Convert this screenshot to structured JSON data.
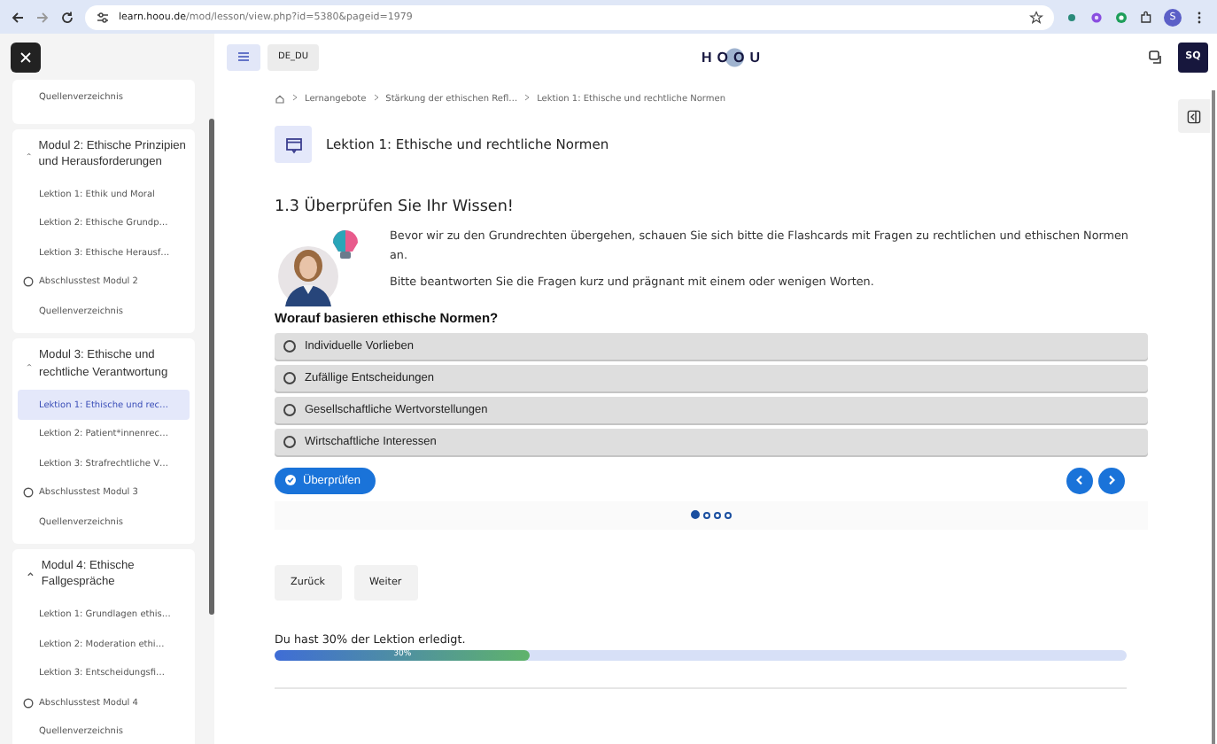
{
  "browser": {
    "url_host": "learn.hoou.de",
    "url_path": "/mod/lesson/view.php?id=5380&pageid=1979",
    "profile": "S"
  },
  "header": {
    "language": "DE_DU",
    "logo": "HOOU",
    "user": "SQ"
  },
  "sidebar": {
    "items": [
      {
        "kind": "sources",
        "label": "Quellenverzeichnis",
        "selected": false
      },
      {
        "kind": "module",
        "label": "Modul 2: Ethische Prinzipien und Herausforderungen",
        "expanded": true,
        "children": [
          {
            "kind": "lesson",
            "label": "Lektion 1: Ethik und Moral",
            "selected": false
          },
          {
            "kind": "lesson",
            "label": "Lektion 2: Ethische Grundp…",
            "selected": false
          },
          {
            "kind": "lesson",
            "label": "Lektion 3: Ethische Herausf…",
            "selected": false
          },
          {
            "kind": "test",
            "label": "Abschlusstest Modul 2",
            "selected": false
          },
          {
            "kind": "lesson",
            "label": "Quellenverzeichnis",
            "selected": false
          }
        ]
      },
      {
        "kind": "module",
        "label": "Modul 3: Ethische und rechtliche Verantwortung",
        "expanded": true,
        "children": [
          {
            "kind": "lesson",
            "label": "Lektion 1: Ethische und rec…",
            "selected": true
          },
          {
            "kind": "lesson",
            "label": "Lektion 2: Patient*innenrec…",
            "selected": false
          },
          {
            "kind": "lesson",
            "label": "Lektion 3: Strafrechtliche V…",
            "selected": false
          },
          {
            "kind": "test",
            "label": "Abschlusstest Modul 3",
            "selected": false
          },
          {
            "kind": "lesson",
            "label": "Quellenverzeichnis",
            "selected": false
          }
        ]
      },
      {
        "kind": "module",
        "label": "Modul 4: Ethische Fallgespräche",
        "expanded": true,
        "children": [
          {
            "kind": "lesson",
            "label": "Lektion 1: Grundlagen ethis…",
            "selected": false
          },
          {
            "kind": "lesson",
            "label": "Lektion 2: Moderation ethi…",
            "selected": false
          },
          {
            "kind": "lesson",
            "label": "Lektion 3: Entscheidungsfi…",
            "selected": false
          },
          {
            "kind": "test",
            "label": "Abschlusstest Modul 4",
            "selected": false
          },
          {
            "kind": "lesson",
            "label": "Quellenverzeichnis",
            "selected": false
          }
        ]
      }
    ]
  },
  "breadcrumb": [
    "Lernangebote",
    "Stärkung der ethischen Refl…",
    "Lektion 1: Ethische und rechtliche Normen"
  ],
  "lesson_title": "Lektion 1: Ethische und rechtliche Normen",
  "section_title": "1.3 Überprüfen Sie Ihr Wissen!",
  "paragraphs": [
    "Bevor wir zu den Grundrechten übergehen, schauen Sie sich bitte die Flashcards mit Fragen zu rechtlichen und ethischen Normen an.",
    "Bitte beantworten Sie die Fragen kurz und prägnant mit einem oder wenigen Worten."
  ],
  "quiz": {
    "question": "Worauf basieren ethische Normen?",
    "options": [
      {
        "label": "Individuelle Vorlieben",
        "selected": false
      },
      {
        "label": "Zufällige Entscheidungen",
        "selected": false
      },
      {
        "label": "Gesellschaftliche Wertvorstellungen",
        "selected": false
      },
      {
        "label": "Wirtschaftliche Interessen",
        "selected": false
      }
    ],
    "check_button": "Überprüfen",
    "dots": [
      {
        "selected": true
      },
      {
        "selected": false
      },
      {
        "selected": false
      },
      {
        "selected": false
      }
    ]
  },
  "nav_buttons": [
    "Zurück",
    "Weiter"
  ],
  "progress": {
    "text": "Du hast 30% der Lektion erledigt.",
    "level": 0.3,
    "label": "30%"
  }
}
